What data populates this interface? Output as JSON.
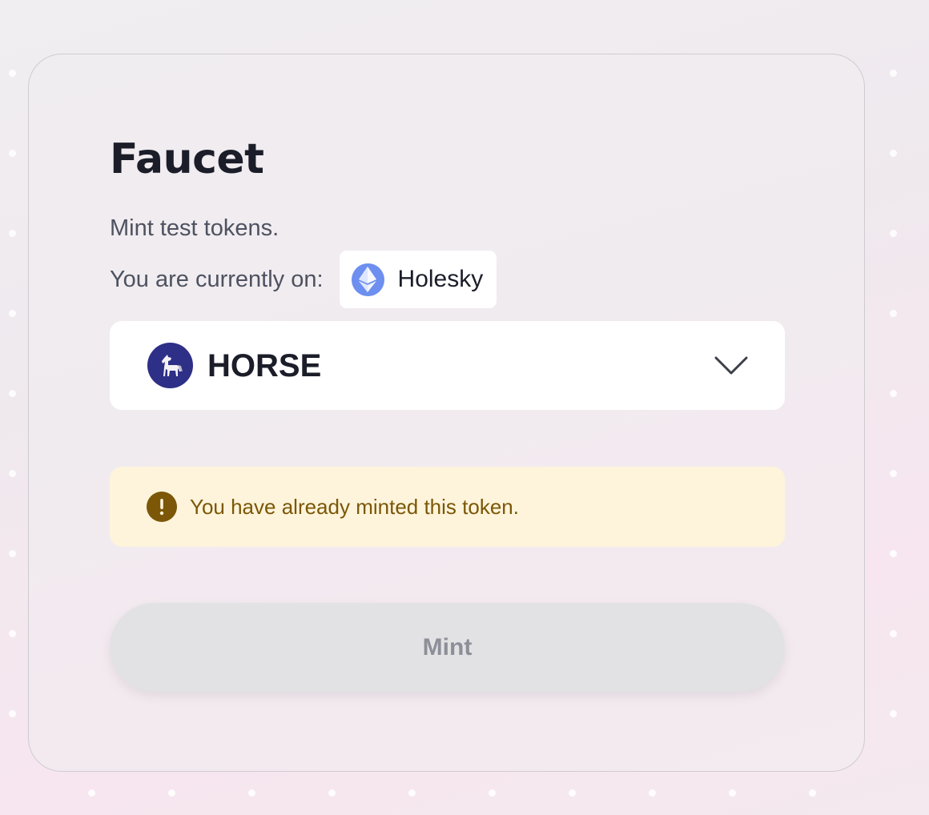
{
  "faucet": {
    "title": "Faucet",
    "subtitle": "Mint test tokens.",
    "network_label": "You are currently on:",
    "network_name": "Holesky",
    "network_icon": "ethereum-icon",
    "selected_token": "HORSE",
    "token_icon": "horse-icon",
    "alert_text": "You have already minted this token.",
    "alert_icon": "exclamation-icon",
    "mint_label": "Mint",
    "mint_disabled": true
  },
  "colors": {
    "title": "#1b1d29",
    "body_text": "#4e5260",
    "alert_background": "#fdf4db",
    "alert_text": "#7b5707",
    "token_icon_background": "#2e2f87",
    "network_icon_background": "#6c8ff0",
    "button_disabled_background": "#e2e2e4",
    "button_disabled_text": "#8d8f98"
  }
}
